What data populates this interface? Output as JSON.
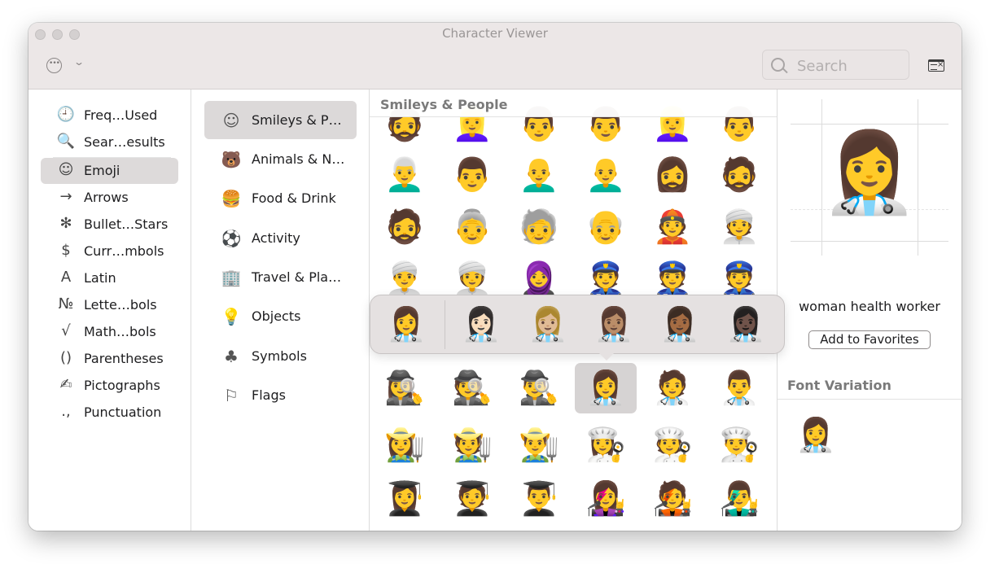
{
  "window": {
    "title": "Character Viewer"
  },
  "toolbar": {
    "more_icon": "ellipsis-circle-icon",
    "chevron_icon": "chevron-down-icon",
    "keyboard_icon": "keyboard-viewer-icon"
  },
  "search": {
    "placeholder": "Search",
    "value": ""
  },
  "categories": [
    {
      "label": "Freq…Used",
      "icon": "🕘"
    },
    {
      "label": "Sear…esults",
      "icon": "🔍"
    },
    {
      "label": "Emoji",
      "icon": "☺"
    },
    {
      "label": "Arrows",
      "icon": "→"
    },
    {
      "label": "Bullet…Stars",
      "icon": "✻"
    },
    {
      "label": "Curr…mbols",
      "icon": "$"
    },
    {
      "label": "Latin",
      "icon": "A"
    },
    {
      "label": "Lette…bols",
      "icon": "№"
    },
    {
      "label": "Math…bols",
      "icon": "√"
    },
    {
      "label": "Parentheses",
      "icon": "()"
    },
    {
      "label": "Pictographs",
      "icon": "✍"
    },
    {
      "label": "Punctuation",
      "icon": ".,"
    }
  ],
  "subcategories": [
    {
      "label": "Smileys & P…",
      "icon": "☺"
    },
    {
      "label": "Animals & N…",
      "icon": "🐻"
    },
    {
      "label": "Food & Drink",
      "icon": "🍔"
    },
    {
      "label": "Activity",
      "icon": "⚽"
    },
    {
      "label": "Travel & Pla…",
      "icon": "🏢"
    },
    {
      "label": "Objects",
      "icon": "💡"
    },
    {
      "label": "Symbols",
      "icon": "♣"
    },
    {
      "label": "Flags",
      "icon": "⚐"
    }
  ],
  "grid": {
    "section_title": "Smileys & People",
    "rows": [
      [
        "🧔",
        "👱‍♀️",
        "👨",
        "👨",
        "👱‍♀️",
        "👨"
      ],
      [
        "👨‍🦳",
        "👨",
        "👨‍🦲",
        "👨‍🦲",
        "🧔‍♀️",
        "🧔"
      ],
      [
        "🧔",
        "👵",
        "🧓",
        "👴",
        "👲",
        "👳"
      ],
      [
        "👳‍♂️",
        "👳‍♀️",
        "🧕",
        "👮",
        "👮",
        "👮"
      ],
      [
        "💂",
        "💂",
        "💂",
        "🧑‍⚕️",
        "🧑‍⚕️",
        "🧑‍⚕️"
      ],
      [
        "🕵️‍♀️",
        "🕵️",
        "🕵️‍♂️",
        "👩‍⚕️",
        "🧑‍⚕️",
        "👨‍⚕️"
      ],
      [
        "👩‍🌾",
        "🧑‍🌾",
        "👨‍🌾",
        "👩‍🍳",
        "🧑‍🍳",
        "👨‍🍳"
      ],
      [
        "👩‍🎓",
        "🧑‍🎓",
        "👨‍🎓",
        "👩‍🎤",
        "🧑‍🎤",
        "👨‍🎤"
      ]
    ]
  },
  "skin_tones": [
    "👩‍⚕️",
    "👩🏻‍⚕️",
    "👩🏼‍⚕️",
    "👩🏽‍⚕️",
    "👩🏾‍⚕️",
    "👩🏿‍⚕️"
  ],
  "preview": {
    "emoji": "👩‍⚕️",
    "name": "woman health worker",
    "favorites_label": "Add to Favorites",
    "font_variation_title": "Font Variation",
    "font_variation_emoji": "👩‍⚕️"
  }
}
